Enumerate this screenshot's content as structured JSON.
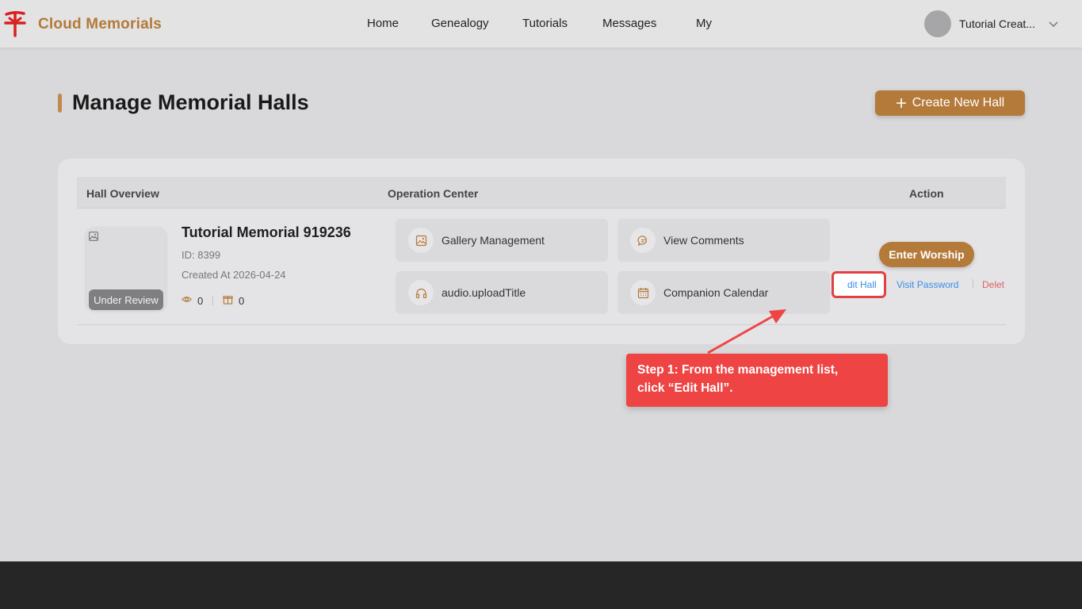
{
  "header": {
    "brand": "Cloud Memorials",
    "nav": [
      {
        "label": "Home"
      },
      {
        "label": "Genealogy"
      },
      {
        "label": "Tutorials"
      },
      {
        "label": "Messages"
      },
      {
        "label": "My"
      }
    ],
    "user_name": "Tutorial Creat..."
  },
  "page": {
    "title": "Manage Memorial Halls",
    "create_label": "Create New Hall"
  },
  "table": {
    "columns": [
      "Hall Overview",
      "Operation Center",
      "Action"
    ],
    "row": {
      "name": "Tutorial Memorial 919236",
      "id": "ID: 8399",
      "created": "Created At 2026-04-24",
      "status": "Under Review",
      "views": "0",
      "gifts": "0",
      "operations": [
        {
          "label": "Gallery Management",
          "icon": "image-icon"
        },
        {
          "label": "View Comments",
          "icon": "chat-icon"
        },
        {
          "label": "audio.uploadTitle",
          "icon": "headphones-icon"
        },
        {
          "label": "Companion Calendar",
          "icon": "calendar-icon"
        }
      ],
      "actions": {
        "worship": "Enter Worship",
        "edit": "dit Hall",
        "visit_password": "Visit Password",
        "delete": "Delet"
      }
    }
  },
  "annotation": {
    "line1": "Step 1: From the management list,",
    "line2": "click “Edit Hall”."
  },
  "colors": {
    "brand": "#b47a3a",
    "link": "#3a8ee6",
    "danger": "#e06060",
    "callout": "#ef4444"
  }
}
